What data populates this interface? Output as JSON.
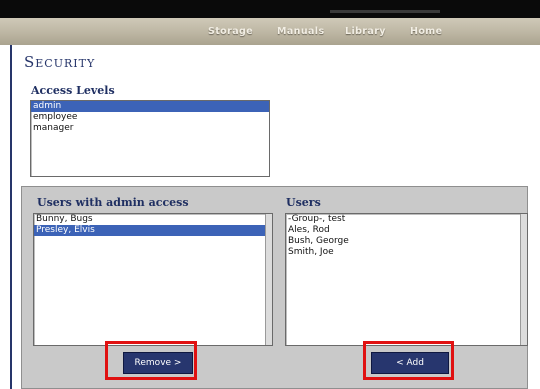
{
  "nav": {
    "items": [
      "Storage",
      "Manuals",
      "Library",
      "Home"
    ]
  },
  "page": {
    "title": "Security"
  },
  "access_levels": {
    "label": "Access Levels",
    "options": [
      "admin",
      "employee",
      "manager"
    ],
    "selected_index": 0
  },
  "users_with_access": {
    "label": "Users with admin access",
    "options": [
      "Bunny, Bugs",
      "Presley, Elvis"
    ],
    "selected_index": 1
  },
  "users": {
    "label": "Users",
    "options": [
      "-Group-, test",
      "Ales, Rod",
      "Bush, George",
      "Smith, Joe"
    ]
  },
  "buttons": {
    "remove": "Remove >",
    "add": "< Add"
  },
  "colors": {
    "accent": "#26356a",
    "selection": "#3c63b7",
    "highlight_box": "#e01111"
  }
}
